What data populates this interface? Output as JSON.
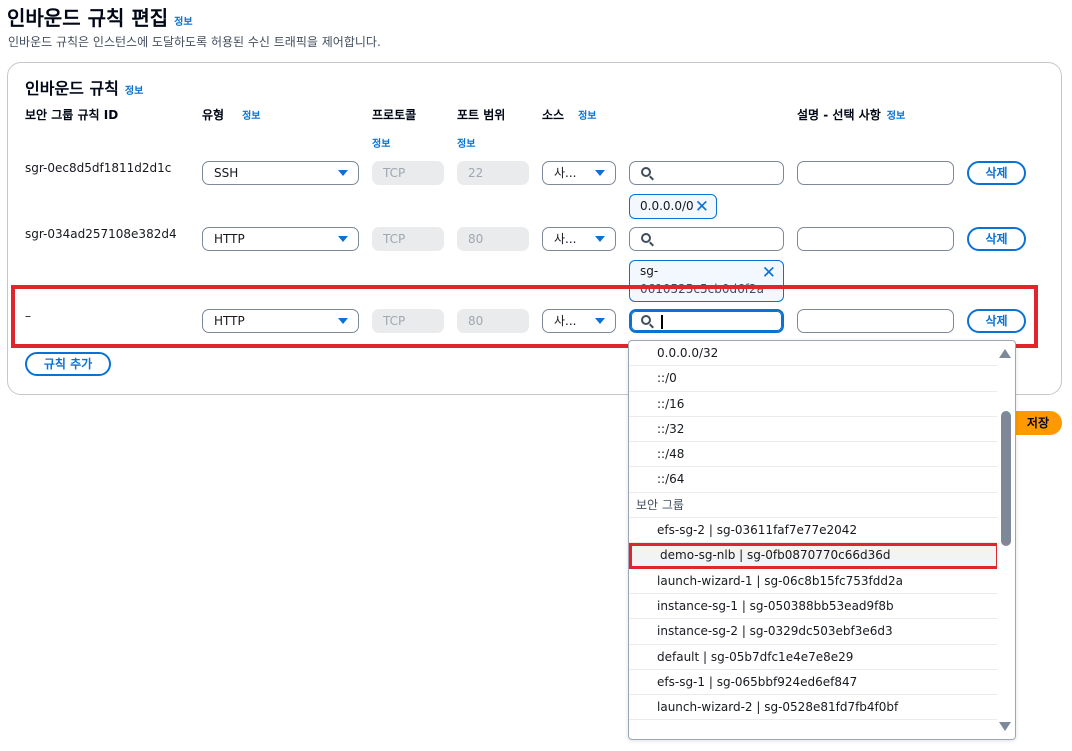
{
  "page": {
    "title": "인바운드 규칙 편집",
    "title_info": "정보",
    "description": "인바운드 규칙은 인스턴스에 도달하도록 허용된 수신 트래픽을 제어합니다."
  },
  "panel": {
    "title": "인바운드 규칙",
    "title_info": "정보",
    "columns": {
      "rule_id": "보안 그룹 규칙 ID",
      "type": "유형",
      "type_info": "정보",
      "protocol": "프로토콜",
      "protocol_info": "정보",
      "port_range": "포트 범위",
      "port_info": "정보",
      "source": "소스",
      "source_info": "정보",
      "description": "설명 - 선택 사항",
      "description_info": "정보"
    },
    "rows": [
      {
        "id": "sgr-0ec8d5df1811d2d1c",
        "type": "SSH",
        "protocol": "TCP",
        "port": "22",
        "source": "사...",
        "token": "0.0.0.0/0",
        "delete": "삭제"
      },
      {
        "id": "sgr-034ad257108e382d4",
        "type": "HTTP",
        "protocol": "TCP",
        "port": "80",
        "source": "사...",
        "token_line1": "sg-",
        "token_line2": "0610525c5cb0d6f2a",
        "delete": "삭제"
      },
      {
        "id": "–",
        "type": "HTTP",
        "protocol": "TCP",
        "port": "80",
        "source": "사...",
        "delete": "삭제"
      }
    ],
    "add_rule": "규칙 추가"
  },
  "footer": {
    "save_fragment": "저장"
  },
  "dropdown": {
    "options_cidr": [
      "0.0.0.0/32",
      "::/0",
      "::/16",
      "::/32",
      "::/48",
      "::/64"
    ],
    "group_label": "보안 그룹",
    "options_sg": [
      "efs-sg-2 | sg-03611faf7e77e2042",
      "demo-sg-nlb | sg-0fb0870770c66d36d",
      "launch-wizard-1 | sg-06c8b15fc753fdd2a",
      "instance-sg-1 | sg-050388bb53ead9f8b",
      "instance-sg-2 | sg-0329dc503ebf3e6d3",
      "default | sg-05b7dfc1e4e7e8e29",
      "efs-sg-1 | sg-065bbf924ed6ef847",
      "launch-wizard-2 | sg-0528e81fd7fb4f0bf"
    ],
    "selected_index": 1
  },
  "colors": {
    "accent": "#0972d3",
    "highlight": "#e0262c",
    "primary_button": "#ff9900"
  }
}
